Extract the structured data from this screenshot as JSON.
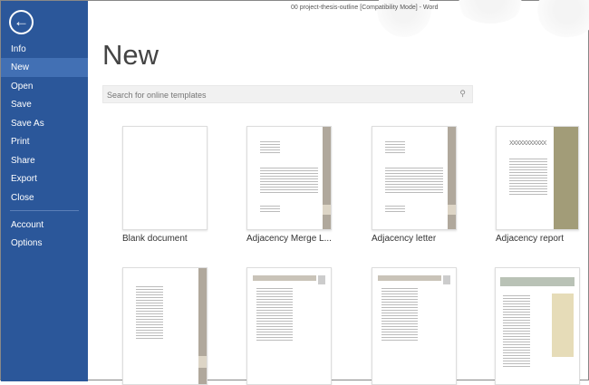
{
  "window": {
    "title": "00 project-thesis-outline [Compatibility Mode] - Word"
  },
  "sidebar": {
    "back_icon": "back-arrow-icon",
    "items": [
      {
        "label": "Info"
      },
      {
        "label": "New"
      },
      {
        "label": "Open"
      },
      {
        "label": "Save"
      },
      {
        "label": "Save As"
      },
      {
        "label": "Print"
      },
      {
        "label": "Share"
      },
      {
        "label": "Export"
      },
      {
        "label": "Close"
      },
      {
        "label": "Account"
      },
      {
        "label": "Options"
      }
    ],
    "selected": "New"
  },
  "main": {
    "title": "New",
    "search": {
      "placeholder": "Search for online templates",
      "value": ""
    },
    "templates": [
      {
        "label": "Blank document"
      },
      {
        "label": "Adjacency Merge L..."
      },
      {
        "label": "Adjacency letter"
      },
      {
        "label": "Adjacency report"
      }
    ]
  },
  "colors": {
    "sidebar": "#2b579a",
    "selected": "#4270b4",
    "accent_bar": "#b0a89c",
    "report_bar": "#a29c78"
  }
}
